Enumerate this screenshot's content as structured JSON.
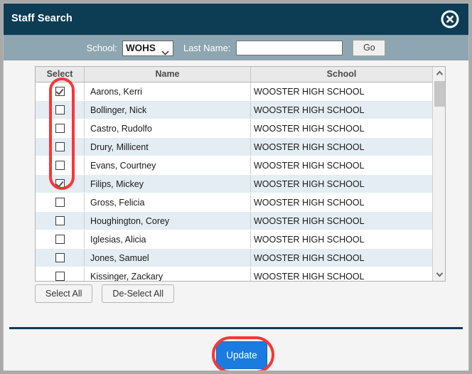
{
  "window": {
    "title": "Staff Search",
    "close_icon": "close-circle-icon",
    "titlebar_color": "#0d3d55",
    "accent_color": "#1a7be0",
    "annotation_color": "#f83636"
  },
  "search": {
    "school_label": "School:",
    "school_selected": "WOHS",
    "school_options": [
      "WOHS"
    ],
    "lastname_label": "Last Name:",
    "lastname_value": "",
    "lastname_placeholder": "",
    "go_label": "Go",
    "bar_color": "#8ea6b1"
  },
  "table": {
    "columns": [
      "Select",
      "Name",
      "School"
    ],
    "rows": [
      {
        "selected": true,
        "name": "Aarons, Kerri",
        "school": "WOOSTER HIGH SCHOOL"
      },
      {
        "selected": false,
        "name": "Bollinger, Nick",
        "school": "WOOSTER HIGH SCHOOL"
      },
      {
        "selected": false,
        "name": "Castro, Rudolfo",
        "school": "WOOSTER HIGH SCHOOL"
      },
      {
        "selected": false,
        "name": "Drury, Millicent",
        "school": "WOOSTER HIGH SCHOOL"
      },
      {
        "selected": false,
        "name": "Evans, Courtney",
        "school": "WOOSTER HIGH SCHOOL"
      },
      {
        "selected": true,
        "name": "Filips, Mickey",
        "school": "WOOSTER HIGH SCHOOL"
      },
      {
        "selected": false,
        "name": "Gross, Felicia",
        "school": "WOOSTER HIGH SCHOOL"
      },
      {
        "selected": false,
        "name": "Houghington, Corey",
        "school": "WOOSTER HIGH SCHOOL"
      },
      {
        "selected": false,
        "name": "Iglesias, Alicia",
        "school": "WOOSTER HIGH SCHOOL"
      },
      {
        "selected": false,
        "name": "Jones, Samuel",
        "school": "WOOSTER HIGH SCHOOL"
      },
      {
        "selected": false,
        "name": "Kissinger, Zackary",
        "school": "WOOSTER HIGH SCHOOL"
      }
    ],
    "scrollbar": {
      "up_icon": "chevron-up-icon",
      "down_icon": "chevron-down-icon",
      "position": "top"
    }
  },
  "actions": {
    "select_all_label": "Select All",
    "deselect_all_label": "De-Select All",
    "update_label": "Update"
  },
  "annotations": [
    {
      "name": "select-column-highlight",
      "shape": "oval"
    },
    {
      "name": "update-button-highlight",
      "shape": "oval"
    }
  ]
}
